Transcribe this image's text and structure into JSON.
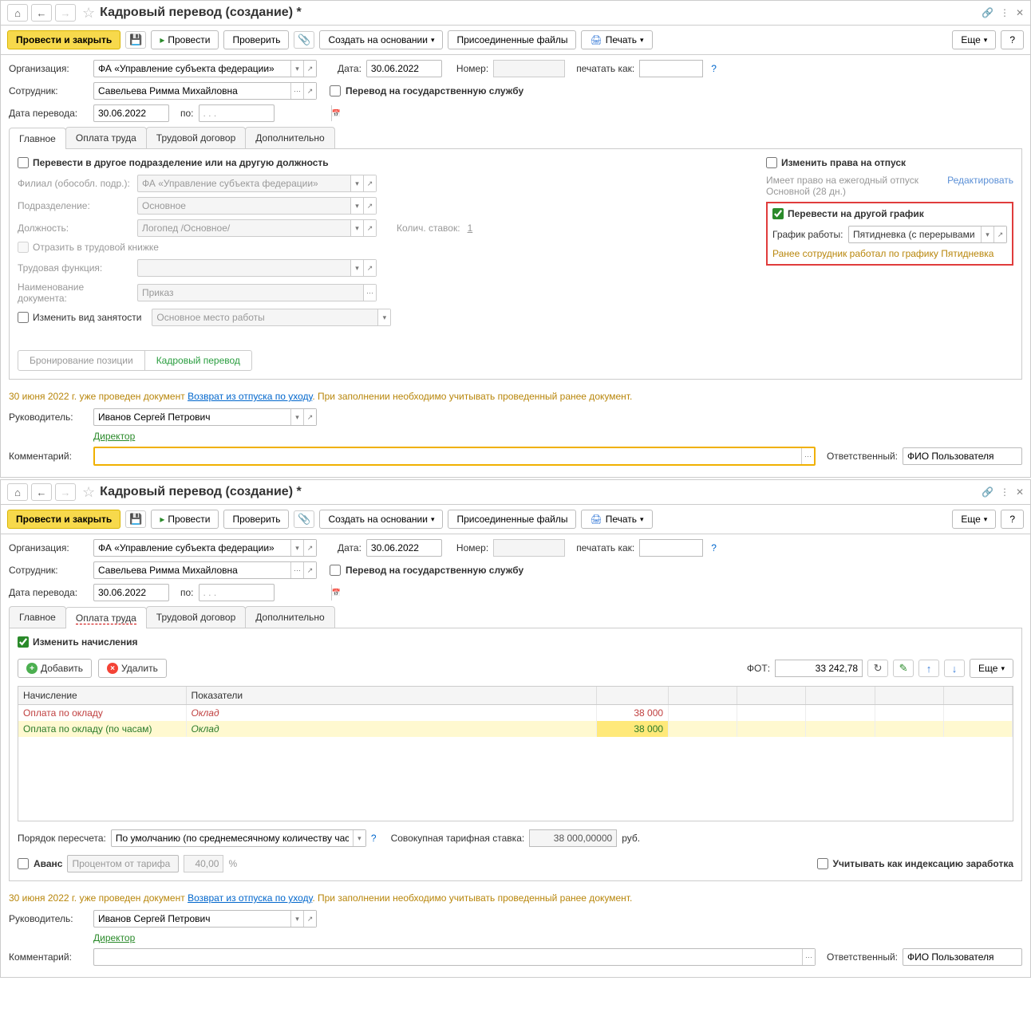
{
  "window1": {
    "title": "Кадровый перевод (создание) *",
    "toolbar": {
      "postClose": "Провести и закрыть",
      "post": "Провести",
      "check": "Проверить",
      "createBy": "Создать на основании",
      "files": "Присоединенные файлы",
      "print": "Печать",
      "more": "Еще",
      "help": "?"
    },
    "fields": {
      "orgLabel": "Организация:",
      "org": "ФА «Управление субъекта федерации»",
      "dateLabel": "Дата:",
      "date": "30.06.2022",
      "numLabel": "Номер:",
      "num": "",
      "printAsLabel": "печатать как:",
      "printAs": "",
      "empLabel": "Сотрудник:",
      "emp": "Савельева Римма Михайловна",
      "govChk": "Перевод на государственную службу",
      "transDateLabel": "Дата перевода:",
      "transDate": "30.06.2022",
      "poLabel": "по:",
      "po": ". . ."
    },
    "tabs": [
      "Главное",
      "Оплата труда",
      "Трудовой договор",
      "Дополнительно"
    ],
    "main": {
      "chkTransfer": "Перевести в другое подразделение или на другую должность",
      "branchLabel": "Филиал (обособл. подр.):",
      "branch": "ФА «Управление субъекта федерации»",
      "deptLabel": "Подразделение:",
      "dept": "Основное",
      "posLabel": "Должность:",
      "pos": "Логопед /Основное/",
      "ratesLabel": "Колич. ставок:",
      "rates": "1",
      "workbookChk": "Отразить в трудовой книжке",
      "funcLabel": "Трудовая функция:",
      "func": "",
      "docNameLabel": "Наименование документа:",
      "docName": "Приказ",
      "chgEmpChk": "Изменить вид занятости",
      "empType": "Основное место работы",
      "resBtn": "Бронирование позиции",
      "transferBtn": "Кадровый перевод",
      "vacChk": "Изменить права на отпуск",
      "vacInfo": "Имеет право на ежегодный отпуск Основной (28 дн.)",
      "vacEdit": "Редактировать",
      "schedChk": "Перевести на другой график",
      "schedLabel": "График работы:",
      "sched": "Пятидневка (с перерывами на кормление)",
      "prevSched": "Ранее сотрудник работал по графику Пятидневка"
    },
    "warning": {
      "prefix": "30 июня 2022 г. уже проведен документ ",
      "link": "Возврат из отпуска по уходу",
      "suffix": ". При заполнении необходимо учитывать проведенный ранее документ."
    },
    "footer": {
      "mgrLabel": "Руководитель:",
      "mgr": "Иванов Сергей Петрович",
      "mgrPos": "Директор",
      "commentLabel": "Комментарий:",
      "comment": "",
      "respLabel": "Ответственный:",
      "resp": "ФИО Пользователя"
    }
  },
  "window2": {
    "title": "Кадровый перевод (создание) *",
    "pay": {
      "chkChange": "Изменить начисления",
      "addBtn": "Добавить",
      "delBtn": "Удалить",
      "fotLabel": "ФОТ:",
      "fot": "33 242,78",
      "moreBtn": "Еще",
      "colAccr": "Начисление",
      "colInd": "Показатели",
      "row1": {
        "accr": "Оплата по окладу",
        "ind": "Оклад",
        "val": "38 000"
      },
      "row2": {
        "accr": "Оплата по окладу (по часам)",
        "ind": "Оклад",
        "val": "38 000"
      },
      "recalcLabel": "Порядок пересчета:",
      "recalc": "По умолчанию (по среднемесячному количеству часов (дней))",
      "aggRateLabel": "Совокупная тарифная ставка:",
      "aggRate": "38 000,00000",
      "curr": "руб.",
      "avansChk": "Аванс",
      "avansType": "Процентом от тарифа",
      "avansVal": "40,00",
      "pct": "%",
      "indexChk": "Учитывать как индексацию заработка"
    }
  }
}
